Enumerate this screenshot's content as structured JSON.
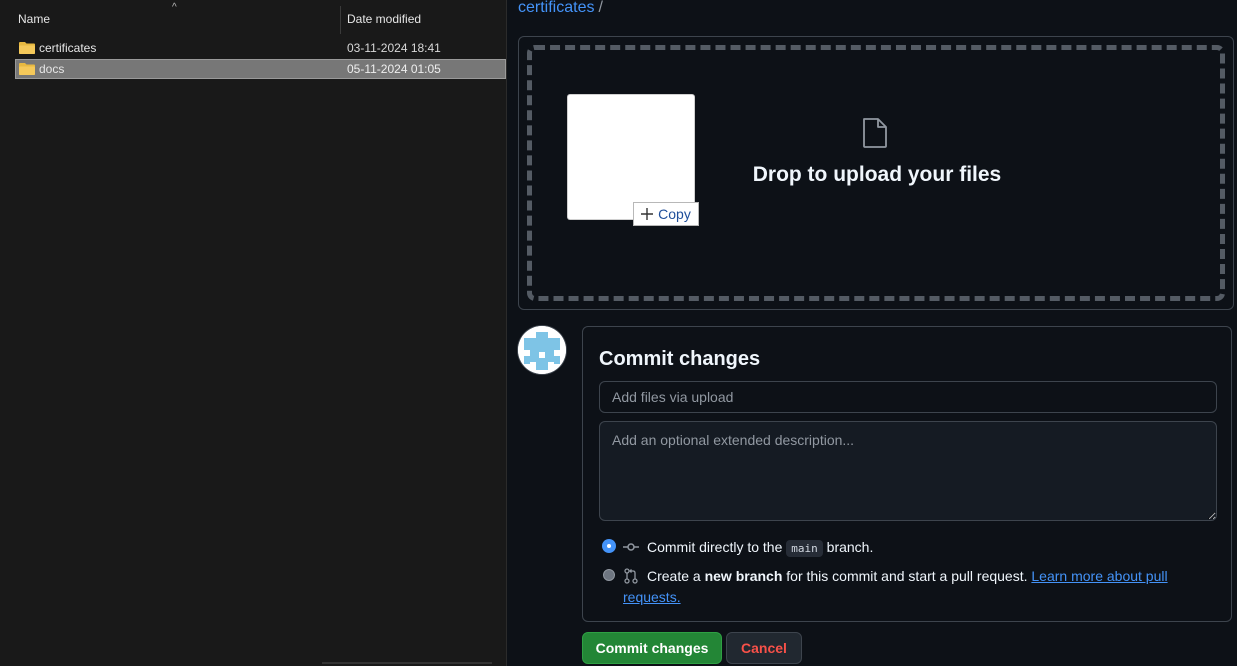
{
  "explorer": {
    "columns": {
      "name": "Name",
      "date_modified": "Date modified"
    },
    "rows": [
      {
        "name": "certificates",
        "date": "03-11-2024 18:41",
        "selected": false
      },
      {
        "name": "docs",
        "date": "05-11-2024 01:05",
        "selected": true
      }
    ]
  },
  "github": {
    "breadcrumb": {
      "folder": "certificates",
      "separator": "/"
    },
    "dropzone": {
      "text": "Drop to upload your files",
      "drag_tooltip": "Copy"
    },
    "commit": {
      "title": "Commit changes",
      "summary_placeholder": "Add files via upload",
      "description_placeholder": "Add an optional extended description...",
      "option_direct": {
        "prefix": "Commit directly to the",
        "branch": "main",
        "suffix": "branch.",
        "checked": true
      },
      "option_new_branch": {
        "prefix": "Create a",
        "bold": "new branch",
        "middle": "for this commit and start a pull request.",
        "link_line1": "Learn more about pull",
        "link_line2": "requests.",
        "checked": false
      },
      "submit_label": "Commit changes",
      "cancel_label": "Cancel"
    }
  },
  "colors": {
    "accent_blue": "#4493f8",
    "commit_green": "#238636",
    "cancel_red": "#f85149",
    "folder_yellow": "#e8b941"
  }
}
